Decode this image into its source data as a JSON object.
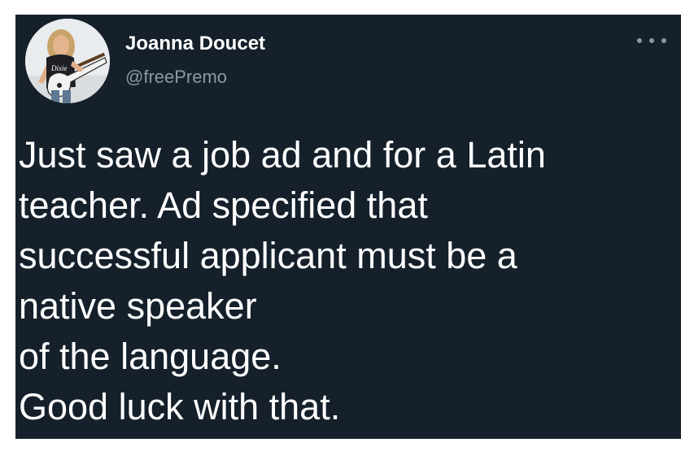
{
  "tweet": {
    "author": {
      "name": "Joanna Doucet",
      "handle": "@freePremo",
      "avatar_icon": "profile-photo-guitarist"
    },
    "more_icon": "more-horizontal-icon",
    "text_lines": [
      "Just saw a job ad and for a Latin",
      "teacher. Ad specified that",
      "successful applicant must be a",
      "native speaker",
      "of the language.",
      "Good luck with that."
    ],
    "colors": {
      "background": "#15202b",
      "name": "#ffffff",
      "handle": "#8b98a5",
      "text": "#ffffff"
    }
  }
}
